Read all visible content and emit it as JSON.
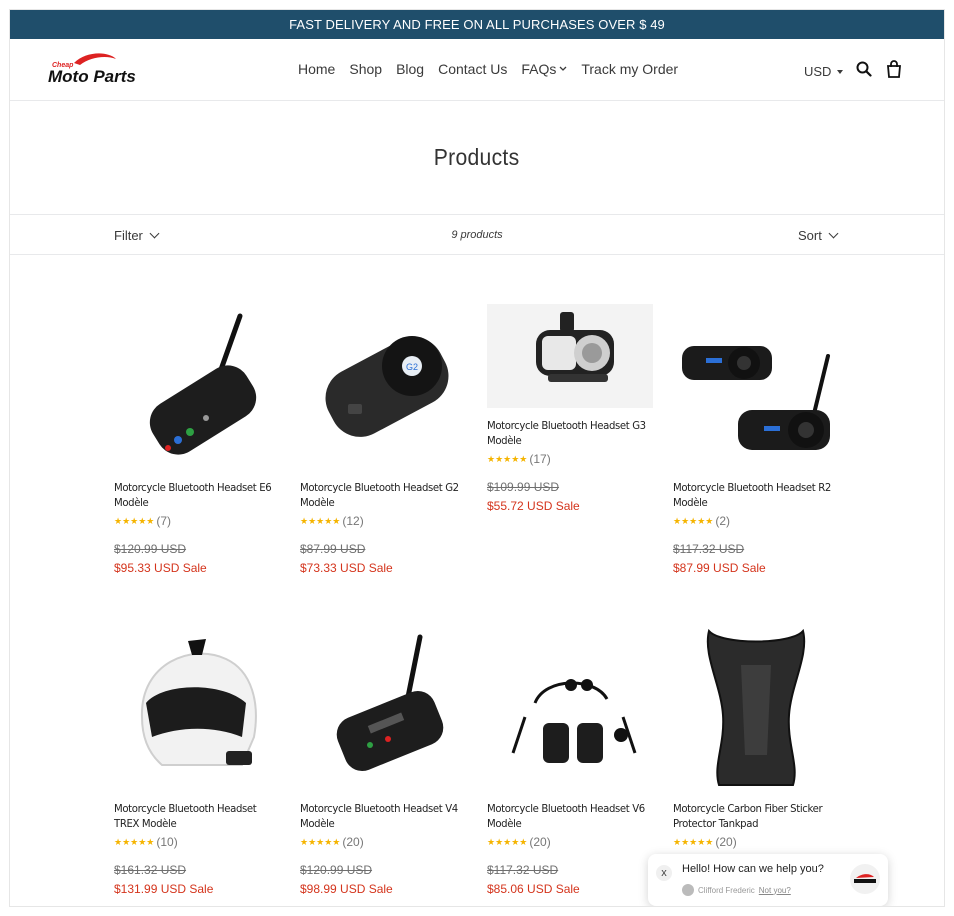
{
  "announcement": "FAST DELIVERY AND FREE ON ALL PURCHASES OVER $ 49",
  "logo": {
    "top": "Cheap",
    "main": "Moto Parts"
  },
  "nav": [
    {
      "label": "Home"
    },
    {
      "label": "Shop"
    },
    {
      "label": "Blog"
    },
    {
      "label": "Contact Us"
    },
    {
      "label": "FAQs"
    },
    {
      "label": "Track my Order"
    }
  ],
  "currency": "USD",
  "icons": [
    "search-icon",
    "cart-icon"
  ],
  "page_title": "Products",
  "filter": {
    "filter_label": "Filter",
    "count": "9 products",
    "sort_label": "Sort"
  },
  "products": [
    {
      "name": "Motorcycle Bluetooth Headset E6 Modèle",
      "rating_count": "(7)",
      "rating": 4.5,
      "old_price": "$120.99 USD",
      "sale_price": "$95.33 USD Sale"
    },
    {
      "name": "Motorcycle Bluetooth Headset G2 Modèle",
      "rating_count": "(12)",
      "rating": 5,
      "old_price": "$87.99 USD",
      "sale_price": "$73.33 USD Sale"
    },
    {
      "name": "Motorcycle Bluetooth Headset G3 Modèle",
      "rating_count": "(17)",
      "rating": 5,
      "old_price": "$109.99 USD",
      "sale_price": "$55.72 USD Sale"
    },
    {
      "name": "Motorcycle Bluetooth Headset R2 Modèle",
      "rating_count": "(2)",
      "rating": 5,
      "old_price": "$117.32 USD",
      "sale_price": "$87.99 USD Sale"
    },
    {
      "name": "Motorcycle Bluetooth Headset TREX Modèle",
      "rating_count": "(10)",
      "rating": 5,
      "old_price": "$161.32 USD",
      "sale_price": "$131.99 USD Sale"
    },
    {
      "name": "Motorcycle Bluetooth Headset V4 Modèle",
      "rating_count": "(20)",
      "rating": 5,
      "old_price": "$120.99 USD",
      "sale_price": "$98.99 USD Sale"
    },
    {
      "name": "Motorcycle Bluetooth Headset V6 Modèle",
      "rating_count": "(20)",
      "rating": 5,
      "old_price": "$117.32 USD",
      "sale_price": "$85.06 USD Sale"
    },
    {
      "name": "Motorcycle Carbon Fiber Sticker Protector Tankpad",
      "rating_count": "(20)",
      "rating": 5,
      "old_price": "",
      "sale_price": ""
    }
  ],
  "stars_text": "★★★★★",
  "chat": {
    "message": "Hello! How can we help you?",
    "agent": "Clifford Frederic",
    "not_you": "Not you?",
    "close": "x"
  },
  "colors": {
    "announcement_bg": "#1f4e6b",
    "sale_red": "#d4341c",
    "star_gold": "#f5b400",
    "logo_red": "#d22"
  }
}
